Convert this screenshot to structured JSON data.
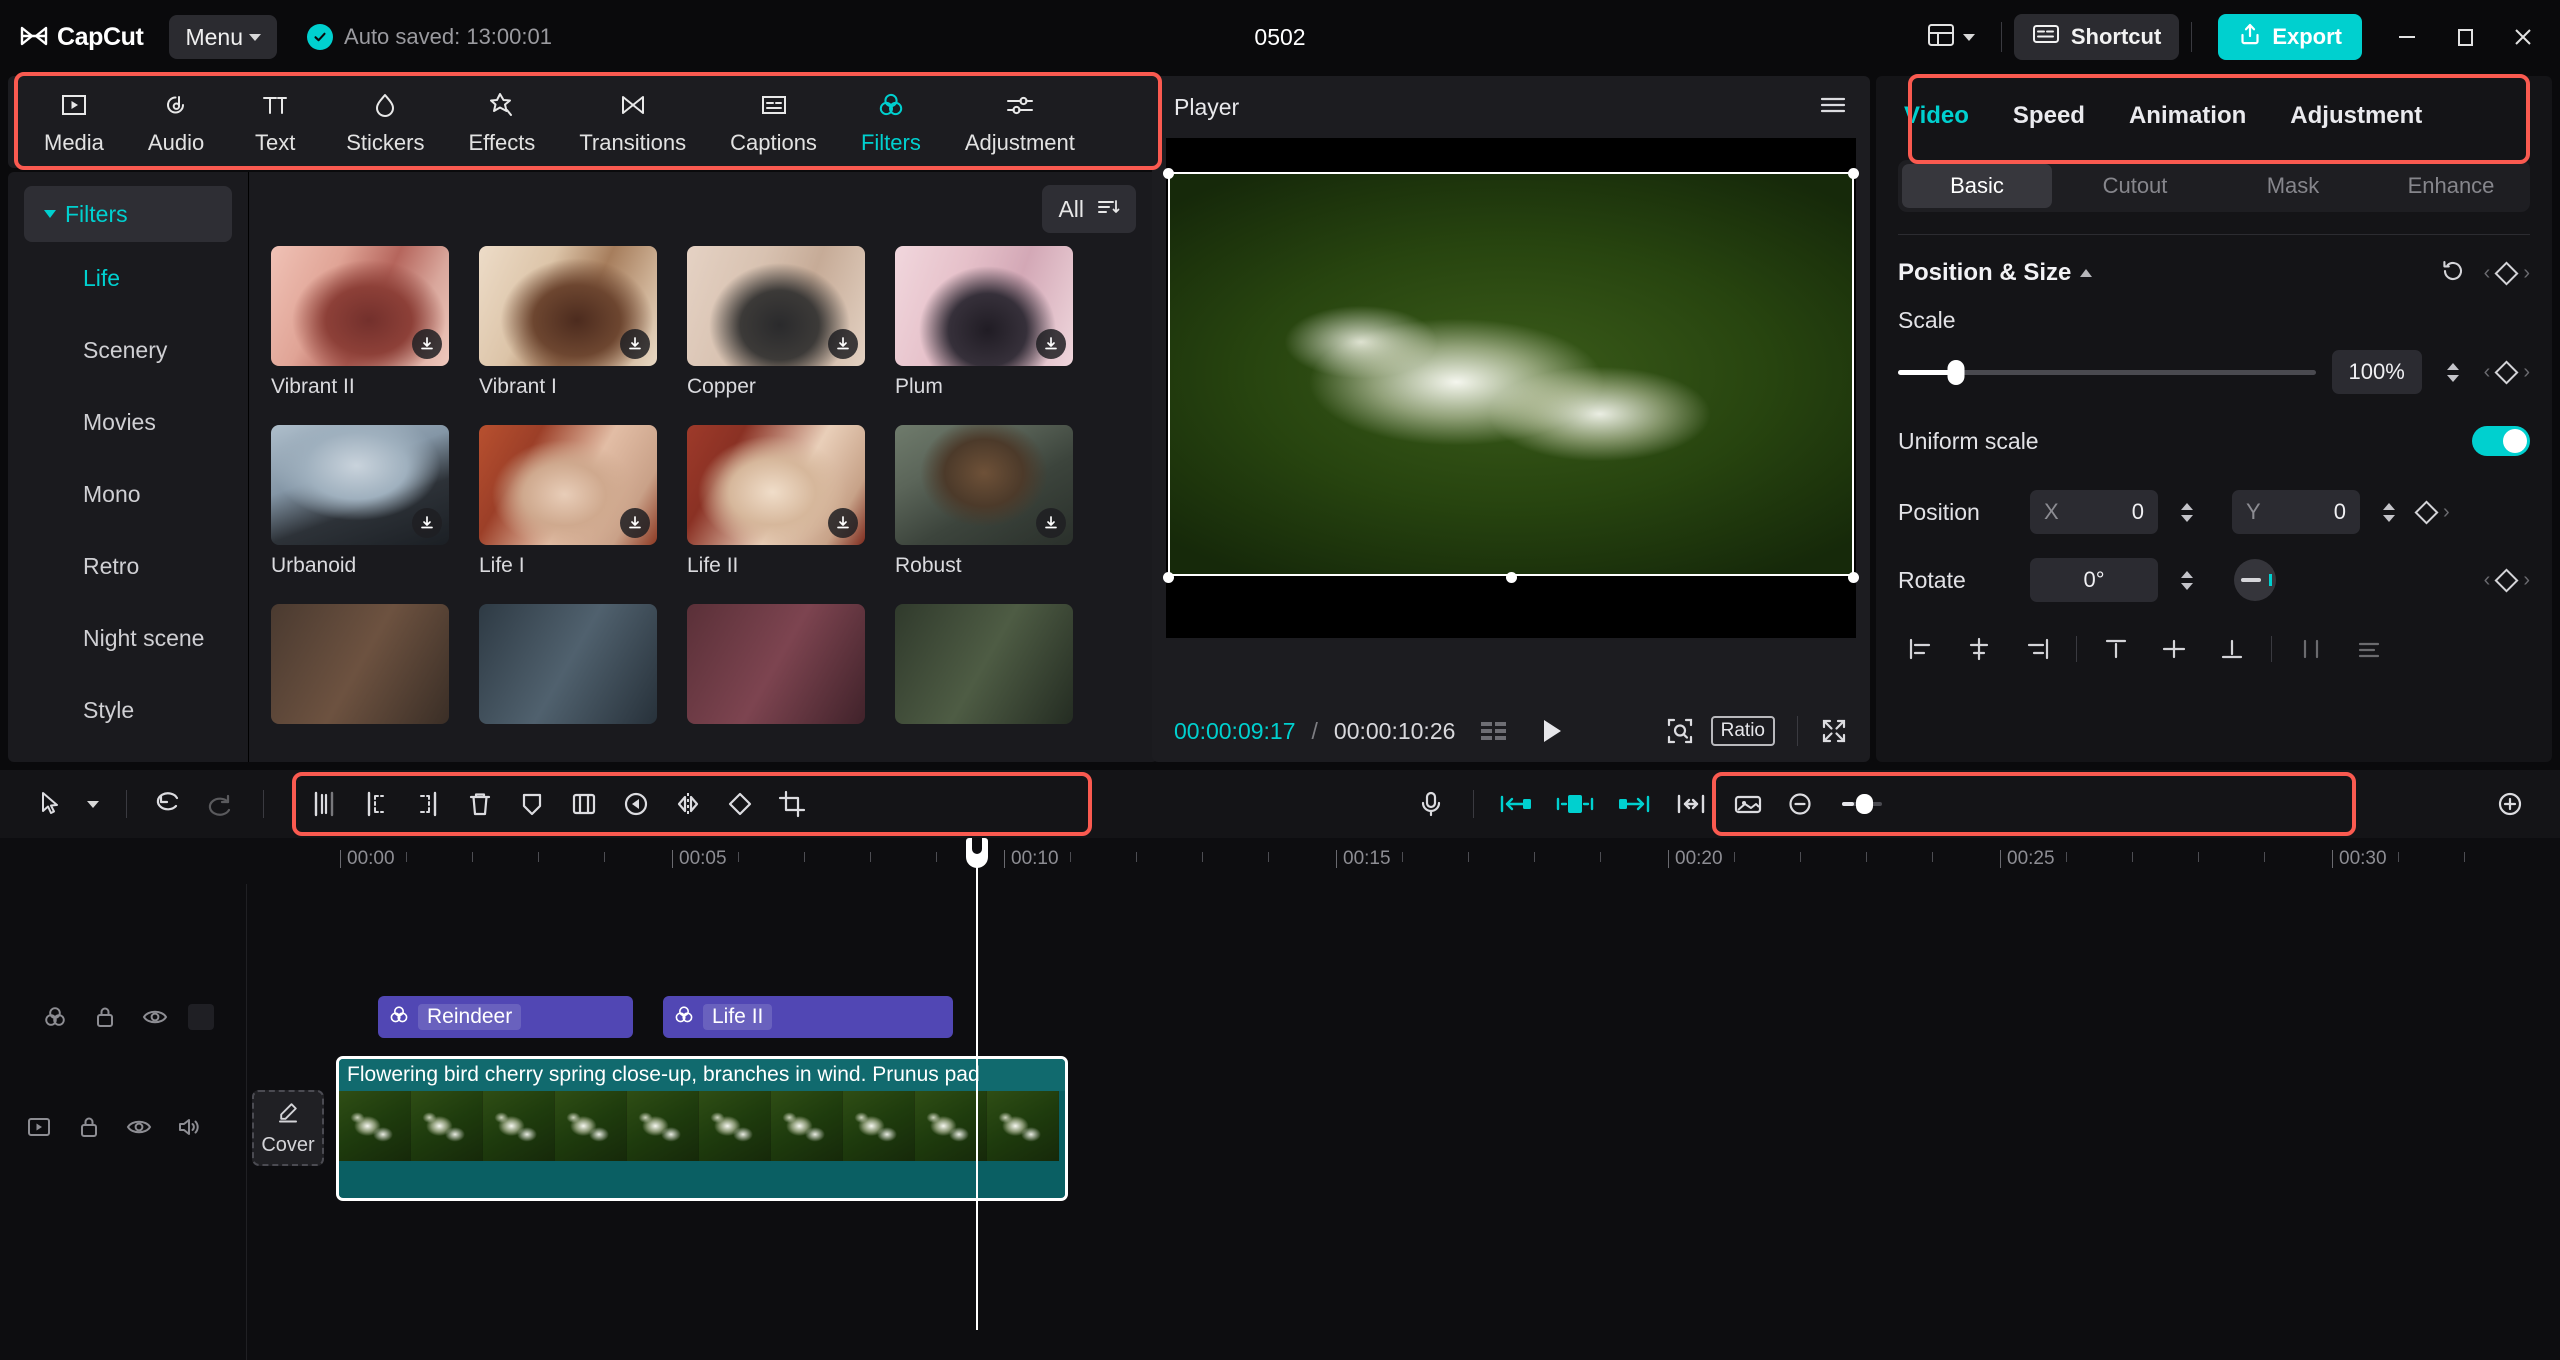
{
  "app": {
    "brand": "CapCut",
    "menu_label": "Menu",
    "autosave_text": "Auto saved: 13:00:01",
    "project_title": "0502",
    "shortcut_label": "Shortcut",
    "export_label": "Export",
    "accent_color": "#00d0cf",
    "annotation_color": "#fa5a50"
  },
  "toolbar": {
    "tabs": [
      {
        "label": "Media",
        "icon": "media-icon",
        "active": false
      },
      {
        "label": "Audio",
        "icon": "audio-icon",
        "active": false
      },
      {
        "label": "Text",
        "icon": "text-icon",
        "active": false
      },
      {
        "label": "Stickers",
        "icon": "stickers-icon",
        "active": false
      },
      {
        "label": "Effects",
        "icon": "effects-icon",
        "active": false
      },
      {
        "label": "Transitions",
        "icon": "transitions-icon",
        "active": false
      },
      {
        "label": "Captions",
        "icon": "captions-icon",
        "active": false
      },
      {
        "label": "Filters",
        "icon": "filters-icon",
        "active": true
      },
      {
        "label": "Adjustment",
        "icon": "adjustment-icon",
        "active": false
      }
    ]
  },
  "filters_panel": {
    "header": "Filters",
    "all_label": "All",
    "categories": [
      {
        "label": "Life",
        "active": true
      },
      {
        "label": "Scenery",
        "active": false
      },
      {
        "label": "Movies",
        "active": false
      },
      {
        "label": "Mono",
        "active": false
      },
      {
        "label": "Retro",
        "active": false
      },
      {
        "label": "Night scene",
        "active": false
      },
      {
        "label": "Style",
        "active": false
      }
    ],
    "items": [
      {
        "label": "Vibrant II",
        "art": "t-vib2",
        "downloadable": true
      },
      {
        "label": "Vibrant I",
        "art": "t-vib1",
        "downloadable": true
      },
      {
        "label": "Copper",
        "art": "t-cop",
        "downloadable": true
      },
      {
        "label": "Plum",
        "art": "t-plum",
        "downloadable": true
      },
      {
        "label": "Urbanoid",
        "art": "t-urb",
        "downloadable": true
      },
      {
        "label": "Life I",
        "art": "t-life1",
        "downloadable": true
      },
      {
        "label": "Life II",
        "art": "t-life2",
        "downloadable": true
      },
      {
        "label": "Robust",
        "art": "t-rob",
        "downloadable": true
      },
      {
        "label": "",
        "art": "t-row3a",
        "downloadable": false
      },
      {
        "label": "",
        "art": "t-row3b",
        "downloadable": false
      },
      {
        "label": "",
        "art": "t-row3c",
        "downloadable": false
      },
      {
        "label": "",
        "art": "t-row3d",
        "downloadable": false
      }
    ]
  },
  "player": {
    "title": "Player",
    "current_time": "00:00:09:17",
    "separator": "/",
    "total_time": "00:00:10:26",
    "ratio_label": "Ratio"
  },
  "properties": {
    "tabs": [
      {
        "label": "Video",
        "active": true
      },
      {
        "label": "Speed",
        "active": false
      },
      {
        "label": "Animation",
        "active": false
      },
      {
        "label": "Adjustment",
        "active": false
      }
    ],
    "subtabs": [
      {
        "label": "Basic",
        "active": true
      },
      {
        "label": "Cutout",
        "active": false
      },
      {
        "label": "Mask",
        "active": false
      },
      {
        "label": "Enhance",
        "active": false
      }
    ],
    "section_title": "Position & Size",
    "scale": {
      "label": "Scale",
      "value": "100%",
      "percent": 14
    },
    "uniform_scale": {
      "label": "Uniform scale",
      "on": true
    },
    "position": {
      "label": "Position",
      "x_axis": "X",
      "x_value": "0",
      "y_axis": "Y",
      "y_value": "0"
    },
    "rotate": {
      "label": "Rotate",
      "value": "0°"
    }
  },
  "timeline": {
    "ruler_marks": [
      "00:00",
      "00:05",
      "00:10",
      "00:15",
      "00:20",
      "00:25",
      "00:30"
    ],
    "cover_label": "Cover",
    "filter_clips": [
      {
        "label": "Reindeer"
      },
      {
        "label": "Life II"
      }
    ],
    "video_clip": {
      "title": "Flowering bird cherry spring close-up, branches in wind. Prunus pad"
    }
  }
}
